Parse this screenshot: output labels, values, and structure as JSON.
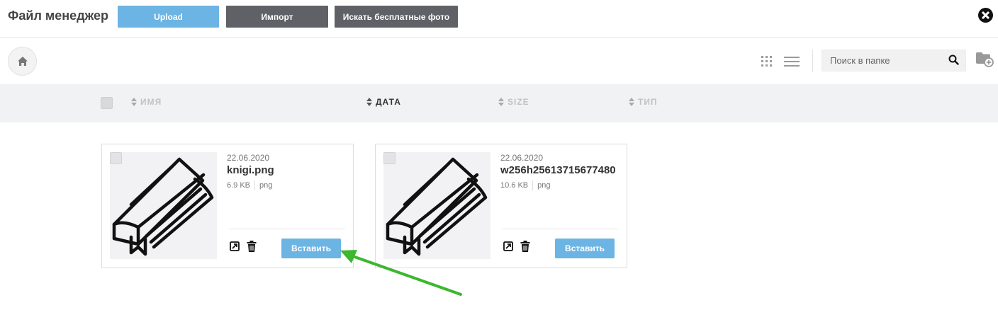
{
  "header": {
    "title": "Файл менеджер",
    "upload_label": "Upload",
    "import_label": "Импорт",
    "free_photos_label": "Искать бесплатные фото"
  },
  "toolbar": {
    "search_placeholder": "Поиск в папке"
  },
  "columns": [
    {
      "label": "ИМЯ",
      "active": false
    },
    {
      "label": "ДАТА",
      "active": true
    },
    {
      "label": "SIZE",
      "active": false
    },
    {
      "label": "ТИП",
      "active": false
    }
  ],
  "files": [
    {
      "date": "22.06.2020",
      "name": "knigi.png",
      "size": "6.9 KB",
      "type": "png",
      "insert_label": "Вставить"
    },
    {
      "date": "22.06.2020",
      "name": "w256h25613715677480",
      "size": "10.6 KB",
      "type": "png",
      "insert_label": "Вставить"
    }
  ],
  "colors": {
    "primary": "#6cb4e4",
    "dark_button": "#5f6166",
    "annotation_arrow": "#3cb72f"
  }
}
